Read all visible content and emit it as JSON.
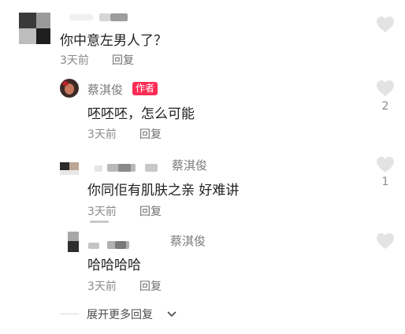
{
  "comments": [
    {
      "author": "",
      "text": "你中意左男人了？",
      "time": "3天前",
      "reply_label": "回复",
      "likes": ""
    },
    {
      "author": "蔡淇俊",
      "author_tag": "作者",
      "text": "呸呸呸，怎么可能",
      "time": "3天前",
      "reply_label": "回复",
      "likes": "2"
    },
    {
      "reply_to": "蔡淇俊",
      "text": "你同佢有肌肤之亲 好难讲",
      "time": "3天前",
      "reply_label": "回复",
      "likes": "1"
    },
    {
      "reply_to": "蔡淇俊",
      "text": "哈哈哈哈",
      "time": "3天前",
      "reply_label": "回复",
      "likes": ""
    }
  ],
  "expand_label": "展开更多回复",
  "colors": {
    "author_tag_bg": "#fe2c55",
    "heart": "#e3e3e3"
  }
}
